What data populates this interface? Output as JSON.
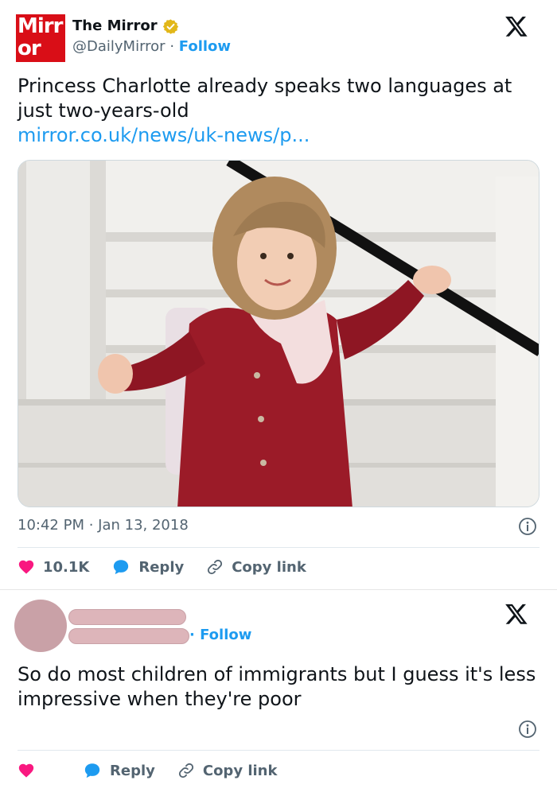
{
  "tweet": {
    "account_name": "The Mirror",
    "logo_text_line1": "Mirr",
    "logo_text_line2": "or",
    "handle": "@DailyMirror",
    "separator": "·",
    "follow_label": "Follow",
    "text": "Princess Charlotte already speaks two languages at just two-years-old",
    "link": "mirror.co.uk/news/uk-news/p...",
    "timestamp": "10:42 PM · Jan 13, 2018",
    "likes": "10.1K",
    "reply_label": "Reply",
    "copy_link_label": "Copy link"
  },
  "reply": {
    "follow_label": "· Follow",
    "text": "So do most children of immigrants but I guess it's less impressive when they're poor",
    "reply_label": "Reply",
    "copy_link_label": "Copy link"
  },
  "colors": {
    "brand_red": "#d90e17",
    "link_blue": "#1d9bf0",
    "like_pink": "#f91880",
    "verified_gold": "#e2b719",
    "redacted_pink": "#ddb5ba"
  },
  "icons": [
    "verified-badge-icon",
    "x-logo-icon",
    "info-icon",
    "heart-icon",
    "reply-bubble-icon",
    "link-icon"
  ]
}
